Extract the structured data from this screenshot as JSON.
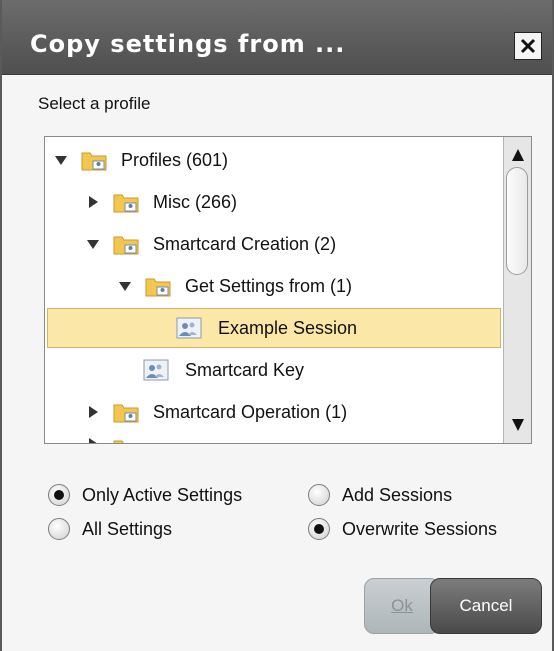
{
  "dialog": {
    "title": "Copy settings from ...",
    "close_icon": "close-icon"
  },
  "section_label": "Select a profile",
  "tree": {
    "items": [
      {
        "label": "Profiles (601)",
        "icon": "folder-profile-icon",
        "expander": "expanded",
        "level": 0,
        "selected": false
      },
      {
        "label": "Misc (266)",
        "icon": "folder-profile-icon",
        "expander": "collapsed",
        "level": 1,
        "selected": false
      },
      {
        "label": "Smartcard Creation (2)",
        "icon": "folder-profile-icon",
        "expander": "expanded",
        "level": 1,
        "selected": false
      },
      {
        "label": "Get Settings from (1)",
        "icon": "folder-profile-icon",
        "expander": "expanded",
        "level": 2,
        "selected": false
      },
      {
        "label": "Example Session",
        "icon": "session-icon",
        "expander": "none",
        "level": 3,
        "selected": true
      },
      {
        "label": "Smartcard Key",
        "icon": "session-icon",
        "expander": "none",
        "level": 2,
        "selected": false
      },
      {
        "label": "Smartcard Operation (1)",
        "icon": "folder-profile-icon",
        "expander": "collapsed",
        "level": 1,
        "selected": false
      }
    ],
    "scrollbar": {
      "up_icon": "scroll-up-arrow-icon",
      "down_icon": "scroll-down-arrow-icon"
    }
  },
  "options": {
    "settings_scope": [
      {
        "label": "Only Active Settings",
        "checked": true
      },
      {
        "label": "All Settings",
        "checked": false
      }
    ],
    "session_mode": [
      {
        "label": "Add Sessions",
        "checked": false
      },
      {
        "label": "Overwrite Sessions",
        "checked": true
      }
    ]
  },
  "buttons": {
    "ok_label": "Ok",
    "cancel_label": "Cancel"
  },
  "colors": {
    "title_bar": "#5a5a5a",
    "selection": "#fbe7a8",
    "folder": "#f3c650"
  }
}
